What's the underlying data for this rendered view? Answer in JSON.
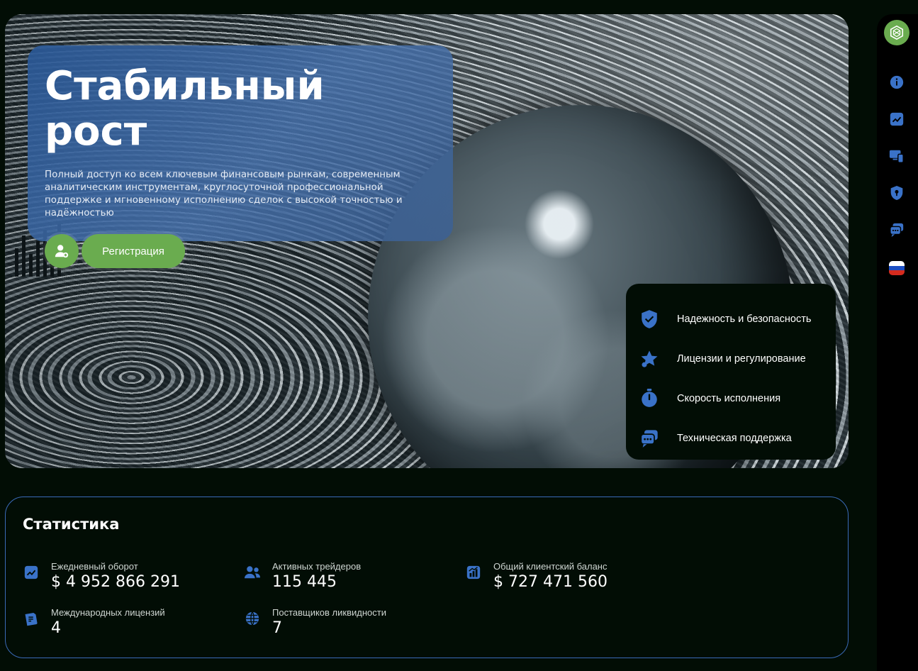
{
  "hero": {
    "title": "Стабильный рост",
    "description": "Полный доступ ко всем ключевым финансовым рынкам, современным аналитическим инструментам, круглосуточной профессиональной поддержке и мгновенному исполнению сделок с высокой точностью и надёжностью",
    "register_label": "Регистрация",
    "register_icon": "user-add-icon"
  },
  "features": [
    {
      "icon": "shield-check-icon",
      "label": "Надежность и безопасность"
    },
    {
      "icon": "star-badge-icon",
      "label": "Лицензии и регулирование"
    },
    {
      "icon": "stopwatch-icon",
      "label": "Скорость исполнения"
    },
    {
      "icon": "chat-bubbles-icon",
      "label": "Техническая поддержка"
    }
  ],
  "sidenav": {
    "logo_icon": "brand-logo-icon",
    "items": [
      {
        "icon": "info-icon"
      },
      {
        "icon": "chart-icon"
      },
      {
        "icon": "devices-icon"
      },
      {
        "icon": "shield-icon"
      },
      {
        "icon": "chat-icon"
      },
      {
        "icon": "russia-flag-icon"
      }
    ]
  },
  "stats": {
    "title": "Статистика",
    "items": [
      {
        "icon": "trend-chart-icon",
        "label": "Ежедневный оборот",
        "value": "$ 4 952 866 291"
      },
      {
        "icon": "users-icon",
        "label": "Активных трейдеров",
        "value": "115 445"
      },
      {
        "icon": "growth-chart-icon",
        "label": "Общий клиентский баланс",
        "value": "$ 727 471 560"
      },
      {
        "icon": "license-icon",
        "label": "Международных лицензий",
        "value": "4"
      },
      {
        "icon": "globe-icon",
        "label": "Поставщиков ликвидности",
        "value": "7"
      }
    ]
  },
  "colors": {
    "accent_blue": "#3a72c8",
    "accent_green": "#6aac4f",
    "background": "#020d05"
  }
}
